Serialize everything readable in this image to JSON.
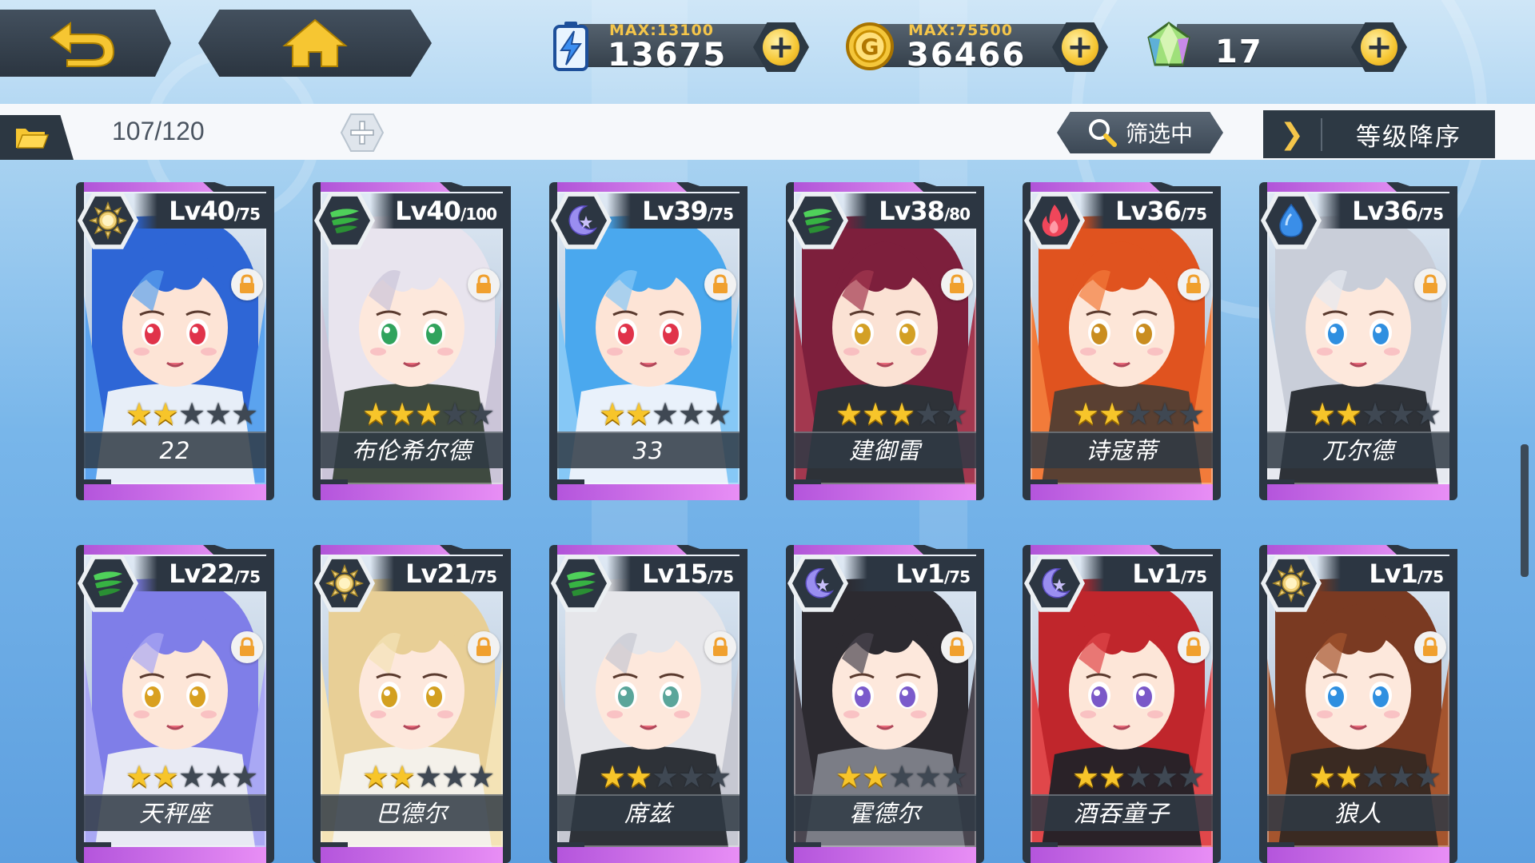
{
  "resources": {
    "energy": {
      "max_label": "MAX:13100",
      "value": "13675",
      "icon": "lightning-battery-icon",
      "color": "#3a8df0"
    },
    "gold": {
      "max_label": "MAX:75500",
      "value": "36466",
      "icon": "gold-coin-icon",
      "color": "#f4c63a"
    },
    "gem": {
      "value": "17",
      "icon": "crystal-gem-icon",
      "color": "#8fd86a"
    }
  },
  "strip": {
    "count": "107/120",
    "filter_label": "筛选中",
    "sort_label": "等级降序"
  },
  "colors": {
    "accent_purple": "#c064e4",
    "panel_dark": "#2c3642",
    "star_gold": "#f7c52a"
  },
  "cards": [
    {
      "name": "22",
      "level": "Lv40",
      "cap": "/75",
      "element": "sun",
      "stars": 2,
      "hair": "#2e66d6",
      "hair2": "#5ba3ee",
      "skin": "#fde4d6",
      "eye": "#e0334a",
      "outfit": "#e7eef8"
    },
    {
      "name": "布伦希尔德",
      "level": "Lv40",
      "cap": "/100",
      "element": "wind",
      "stars": 3,
      "hair": "#e8e4ee",
      "hair2": "#cbc5d8",
      "skin": "#fde8dc",
      "eye": "#30a35d",
      "outfit": "#3f4a40"
    },
    {
      "name": "33",
      "level": "Lv39",
      "cap": "/75",
      "element": "moon",
      "stars": 2,
      "hair": "#4aa8ee",
      "hair2": "#86c8f6",
      "skin": "#fde4d6",
      "eye": "#e0334a",
      "outfit": "#e9f1fb"
    },
    {
      "name": "建御雷",
      "level": "Lv38",
      "cap": "/80",
      "element": "wind",
      "stars": 3,
      "hair": "#7d1f3c",
      "hair2": "#a3384f",
      "skin": "#fbe2d4",
      "eye": "#d3a025",
      "outfit": "#2e3238"
    },
    {
      "name": "诗寇蒂",
      "level": "Lv36",
      "cap": "/75",
      "element": "fire",
      "stars": 2,
      "hair": "#e0531f",
      "hair2": "#f27b3a",
      "skin": "#fde6d8",
      "eye": "#c98d20",
      "outfit": "#5a4032"
    },
    {
      "name": "兀尔德",
      "level": "Lv36",
      "cap": "/75",
      "element": "water",
      "stars": 2,
      "hair": "#c9ced9",
      "hair2": "#e6e9f0",
      "skin": "#fde8dc",
      "eye": "#2f8fe0",
      "outfit": "#2e3238"
    },
    {
      "name": "天秤座",
      "level": "Lv22",
      "cap": "/75",
      "element": "wind",
      "stars": 2,
      "hair": "#7f7ee8",
      "hair2": "#a9a8f4",
      "skin": "#fde6d8",
      "eye": "#d9a020",
      "outfit": "#e8eaf4"
    },
    {
      "name": "巴德尔",
      "level": "Lv21",
      "cap": "/75",
      "element": "sun",
      "stars": 2,
      "hair": "#e8cf96",
      "hair2": "#f4e3b6",
      "skin": "#fde8dc",
      "eye": "#d3a020",
      "outfit": "#f4f1ea"
    },
    {
      "name": "席兹",
      "level": "Lv15",
      "cap": "/75",
      "element": "wind",
      "stars": 2,
      "hair": "#e6e6ea",
      "hair2": "#c6c8d2",
      "skin": "#fde8dc",
      "eye": "#5aa59a",
      "outfit": "#2e3238"
    },
    {
      "name": "霍德尔",
      "level": "Lv1",
      "cap": "/75",
      "element": "moon",
      "stars": 2,
      "hair": "#2c2a30",
      "hair2": "#4a4650",
      "skin": "#fde8dc",
      "eye": "#7a5acb",
      "outfit": "#7b7d86"
    },
    {
      "name": "酒吞童子",
      "level": "Lv1",
      "cap": "/75",
      "element": "moon",
      "stars": 2,
      "hair": "#c0262c",
      "hair2": "#e0474a",
      "skin": "#fde6d8",
      "eye": "#7a58c8",
      "outfit": "#2a2228"
    },
    {
      "name": "狼人",
      "level": "Lv1",
      "cap": "/75",
      "element": "sun",
      "stars": 2,
      "hair": "#7a3a22",
      "hair2": "#a5552e",
      "skin": "#fde8dc",
      "eye": "#2f8fe0",
      "outfit": "#3a2a22"
    }
  ]
}
